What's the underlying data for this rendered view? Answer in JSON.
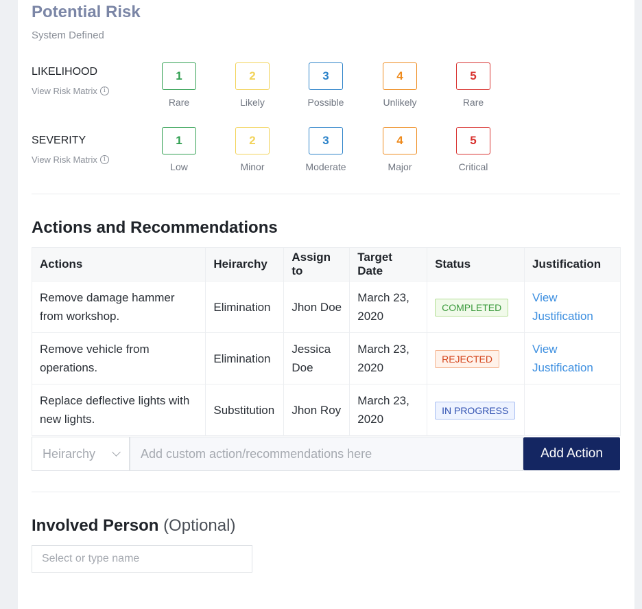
{
  "risk": {
    "title": "Potential Risk",
    "subtitle": "System Defined",
    "view_matrix_label": "View Risk Matrix",
    "info_glyph": "i",
    "likelihood": {
      "label": "LIKELIHOOD",
      "options": [
        {
          "value": "1",
          "caption": "Rare",
          "color": "#2e9e4f"
        },
        {
          "value": "2",
          "caption": "Likely",
          "color": "#f2d35a"
        },
        {
          "value": "3",
          "caption": "Possible",
          "color": "#2b82c9"
        },
        {
          "value": "4",
          "caption": "Unlikely",
          "color": "#ee8a1c"
        },
        {
          "value": "5",
          "caption": "Rare",
          "color": "#d8322f"
        }
      ]
    },
    "severity": {
      "label": "SEVERITY",
      "options": [
        {
          "value": "1",
          "caption": "Low",
          "color": "#2e9e4f"
        },
        {
          "value": "2",
          "caption": "Minor",
          "color": "#f2d35a"
        },
        {
          "value": "3",
          "caption": "Moderate",
          "color": "#2b82c9"
        },
        {
          "value": "4",
          "caption": "Major",
          "color": "#ee8a1c"
        },
        {
          "value": "5",
          "caption": "Critical",
          "color": "#d8322f"
        }
      ]
    }
  },
  "actions": {
    "title": "Actions and Recommendations",
    "columns": [
      "Actions",
      "Heirarchy",
      "Assign to",
      "Target Date",
      "Status",
      "Justification"
    ],
    "rows": [
      {
        "action": "Remove damage hammer from workshop.",
        "hierarchy": "Elimination",
        "assignee": "Jhon Doe",
        "target_date": "March 23, 2020",
        "status": "COMPLETED",
        "status_style": "completed",
        "justification": "View Justification"
      },
      {
        "action": "Remove vehicle from operations.",
        "hierarchy": "Elimination",
        "assignee": "Jessica Doe",
        "target_date": "March 23, 2020",
        "status": "REJECTED",
        "status_style": "rejected",
        "justification": "View Justification"
      },
      {
        "action": "Replace deflective lights with new lights.",
        "hierarchy": "Substitution",
        "assignee": "Jhon Roy",
        "target_date": "March 23, 2020",
        "status": "IN PROGRESS",
        "status_style": "progress",
        "justification": ""
      }
    ],
    "hierarchy_select": "Heirarchy",
    "custom_placeholder": "Add custom action/recommendations here",
    "add_button": "Add Action"
  },
  "status_styles": {
    "completed": {
      "color": "#3a9a3c",
      "bg": "#f1faea",
      "border": "#b4df96"
    },
    "rejected": {
      "color": "#d4461d",
      "bg": "#fff2ea",
      "border": "#f5b693"
    },
    "progress": {
      "color": "#2d4eb0",
      "bg": "#eef3ff",
      "border": "#a9bff2"
    }
  },
  "involved": {
    "title": "Involved Person",
    "optional": "(Optional)",
    "placeholder": "Select or type name"
  }
}
